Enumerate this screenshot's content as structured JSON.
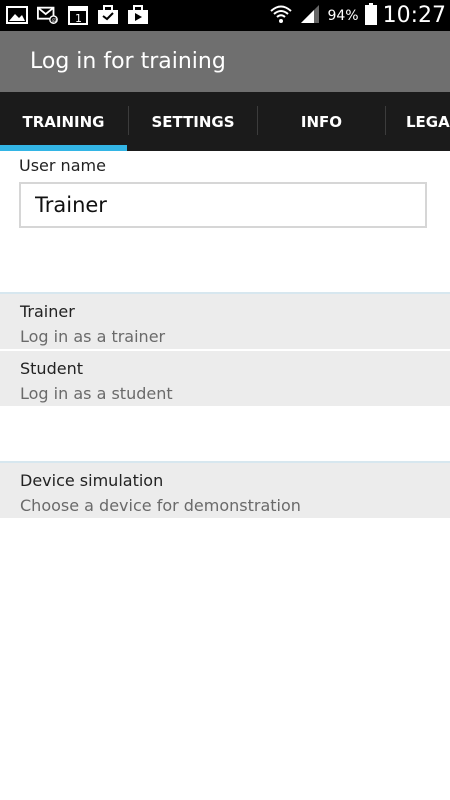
{
  "status_bar": {
    "icons": [
      "gallery-icon",
      "email-icon",
      "calendar-icon",
      "briefcase-icon",
      "play-store-icon"
    ],
    "calendar_day": "1",
    "battery_percent": "94%",
    "time": "10:27"
  },
  "app_bar": {
    "title": "Log in for training"
  },
  "tabs": [
    {
      "label": "TRAINING",
      "selected": true
    },
    {
      "label": "SETTINGS",
      "selected": false
    },
    {
      "label": "INFO",
      "selected": false
    },
    {
      "label": "LEGAL",
      "selected": false
    }
  ],
  "login": {
    "username_label": "User name",
    "username_value": "Trainer"
  },
  "roles": [
    {
      "title": "Trainer",
      "subtitle": "Log in as a trainer"
    },
    {
      "title": "Student",
      "subtitle": "Log in as a student"
    }
  ],
  "device_simulation": {
    "title": "Device simulation",
    "subtitle": "Choose a device for demonstration"
  },
  "colors": {
    "status_bar": "#000000",
    "app_bar": "#6f6f6f",
    "tab_bar": "#1b1b1b",
    "tab_indicator": "#33b5e5",
    "list_background": "#ececec"
  }
}
